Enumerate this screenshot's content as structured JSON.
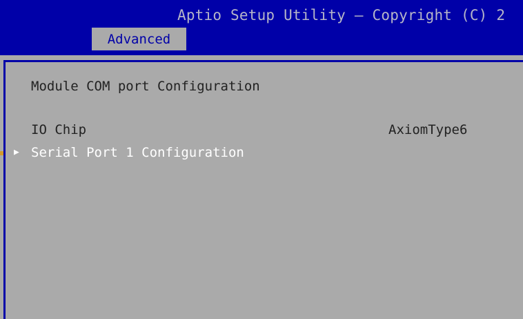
{
  "header": {
    "title": "Aptio Setup Utility – Copyright (C) 2",
    "active_tab": "Advanced"
  },
  "main": {
    "heading": "Module COM port Configuration",
    "io_chip": {
      "label": "IO Chip",
      "value": "AxiomType6"
    },
    "submenu": {
      "label": "Serial Port 1 Configuration",
      "arrow_icon": "triangle-right-icon"
    }
  },
  "colors": {
    "header_bg": "#0000a8",
    "panel_bg": "#aaaaaa",
    "highlight_text": "#ffffff",
    "text": "#222222",
    "title_text": "#b6b6c8"
  }
}
